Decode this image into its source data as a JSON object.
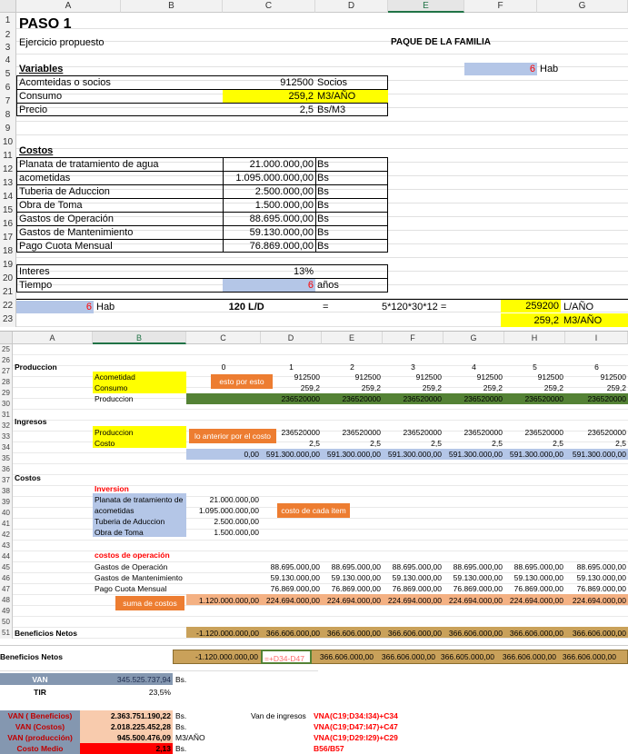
{
  "sheet1": {
    "columns": [
      "A",
      "B",
      "C",
      "D",
      "E",
      "F",
      "G"
    ],
    "rows": [
      "1",
      "2",
      "3",
      "4",
      "5",
      "6",
      "7",
      "8",
      "9",
      "10",
      "11",
      "12",
      "13",
      "14",
      "15",
      "16",
      "17",
      "18",
      "19",
      "20",
      "21",
      "22",
      "23"
    ],
    "title": "PASO 1",
    "subtitle": "Ejercicio propuesto",
    "family_pack": "PAQUE DE LA FAMILIA",
    "hab_value": "6",
    "hab_label": "Hab",
    "variables_title": "Variables",
    "variables": [
      {
        "label": "Acomteidas o socios",
        "value": "912500",
        "unit": "Socios"
      },
      {
        "label": "Consumo",
        "value": "259,2",
        "unit": "M3/AÑO"
      },
      {
        "label": "Precio",
        "value": "2,5",
        "unit": "Bs/M3"
      }
    ],
    "costos_title": "Costos",
    "costos": [
      {
        "label": "Planata de tratamiento de agua",
        "value": "21.000.000,00",
        "unit": "Bs"
      },
      {
        "label": "acometidas",
        "value": "1.095.000.000,00",
        "unit": "Bs"
      },
      {
        "label": "Tuberia de Aduccion",
        "value": "2.500.000,00",
        "unit": "Bs"
      },
      {
        "label": "Obra de Toma",
        "value": "1.500.000,00",
        "unit": "Bs"
      },
      {
        "label": "Gastos de Operación",
        "value": "88.695.000,00",
        "unit": "Bs"
      },
      {
        "label": "Gastos de Mantenimiento",
        "value": "59.130.000,00",
        "unit": "Bs"
      },
      {
        "label": "Pago Cuota Mensual",
        "value": "76.869.000,00",
        "unit": "Bs"
      }
    ],
    "interes_label": "Interes",
    "interes_value": "13%",
    "tiempo_label": "Tiempo",
    "tiempo_value": "6",
    "tiempo_unit": "años",
    "row21": {
      "hab_value": "6",
      "hab_label": "Hab",
      "ld": "120",
      "ld_unit": "L/D",
      "eq": "=",
      "formula": "5*120*30*12 =",
      "result": "259200",
      "result_unit": "L/AÑO"
    },
    "row22": {
      "value": "259,2",
      "unit": "M3/AÑO"
    }
  },
  "sheet2": {
    "columns": [
      "A",
      "B",
      "C",
      "D",
      "E",
      "F",
      "G",
      "H",
      "I"
    ],
    "rows": [
      "25",
      "26",
      "27",
      "28",
      "29",
      "30",
      "31",
      "32",
      "33",
      "34",
      "35",
      "36",
      "37",
      "38",
      "39",
      "40",
      "41",
      "42",
      "43",
      "44",
      "45",
      "46",
      "47",
      "48",
      "49",
      "50",
      "51"
    ],
    "produccion_title": "Produccion",
    "years": [
      "0",
      "1",
      "2",
      "3",
      "4",
      "5",
      "6"
    ],
    "acometidad_label": "Acometidad",
    "consumo_label": "Consumo",
    "produccion_label": "Produccion",
    "note_esto": "esto por esto",
    "acometidad_vals": [
      "912500",
      "912500",
      "912500",
      "912500",
      "912500",
      "912500"
    ],
    "consumo_vals": [
      "259,2",
      "259,2",
      "259,2",
      "259,2",
      "259,2",
      "259,2"
    ],
    "produccion_vals": [
      "236520000",
      "236520000",
      "236520000",
      "236520000",
      "236520000",
      "236520000"
    ],
    "ingresos_title": "Ingresos",
    "ing_produccion_label": "Produccion",
    "ing_costo_label": "Costo",
    "note_anterior": "lo anterior por el costo",
    "ing_prod_vals": [
      "236520000",
      "236520000",
      "236520000",
      "236520000",
      "236520000",
      "236520000"
    ],
    "ing_costo_vals": [
      "2,5",
      "2,5",
      "2,5",
      "2,5",
      "2,5",
      "2,5"
    ],
    "ing_total_first": "0,00",
    "ing_total_vals": [
      "591.300.000,00",
      "591.300.000,00",
      "591.300.000,00",
      "591.300.000,00",
      "591.300.000,00",
      "591.300.000,00"
    ],
    "costos_title": "Costos",
    "inversion_title": "Inversion",
    "inversion": [
      {
        "label": "Planata de tratamiento de",
        "value": "21.000.000,00"
      },
      {
        "label": "acometidas",
        "value": "1.095.000.000,00"
      },
      {
        "label": "Tuberia de Aduccion",
        "value": "2.500.000,00"
      },
      {
        "label": "Obra de Toma",
        "value": "1.500.000,00"
      }
    ],
    "note_cada": "costo de cada item",
    "operacion_title": "costos de operación",
    "operacion": [
      {
        "label": "Gastos de Operación",
        "value": "88.695.000,00"
      },
      {
        "label": "Gastos de Mantenimiento",
        "value": "59.130.000,00"
      },
      {
        "label": "Pago Cuota Mensual",
        "value": "76.869.000,00"
      }
    ],
    "note_suma": "suma de costos",
    "costos_total_first": "1.120.000.000,00",
    "costos_total_vals": [
      "224.694.000,00",
      "224.694.000,00",
      "224.694.000,00",
      "224.694.000,00",
      "224.694.000,00",
      "224.694.000,00"
    ],
    "beneficios_label": "Beneficios Netos",
    "beneficios_first": "-1.120.000.000,00",
    "beneficios_vals": [
      "366.606.000,00",
      "366.606.000,00",
      "366.606.000,00",
      "366.606.000,00",
      "366.606.000,00",
      "366.606.000,00"
    ]
  },
  "footer": {
    "beneficios_label": "Beneficios Netos",
    "beneficios_first": "-1.120.000.000,00",
    "edit_formula": "=+D34-D47",
    "beneficios_vals": [
      "366.606.000,00",
      "366.606.000,00",
      "366.605.000,00",
      "366.606.000,00",
      "366.606.000,00",
      "366.606.000,00"
    ],
    "van_label": "VAN",
    "van_value": "345.525.737,94",
    "van_unit": "Bs.",
    "tir_label": "TIR",
    "tir_value": "23,5%",
    "van_rows": [
      {
        "label": "VAN ( Beneficios)",
        "value": "2.363.751.190,22",
        "unit": "Bs."
      },
      {
        "label": "VAN (Costos)",
        "value": "2.018.225.452,28",
        "unit": "Bs."
      },
      {
        "label": "VAN (producción)",
        "value": "945.500.476,09",
        "unit": "M3/AÑO"
      },
      {
        "label": "Costo Medio",
        "value": "2,13",
        "unit": "Bs."
      }
    ],
    "van_ingresos_label": "Van de ingresos",
    "formulas": [
      "VNA(C19;D34:I34)+C34",
      "VNA(C19;D47:I47)+C47",
      "VNA(C19;D29:I29)+C29",
      "B56/B57"
    ]
  }
}
